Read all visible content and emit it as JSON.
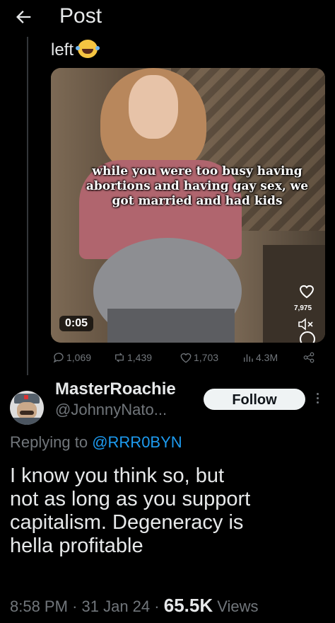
{
  "header": {
    "title": "Post",
    "back_icon": "arrow-left-icon"
  },
  "quoted_post": {
    "text": "left",
    "emoji": "face-with-tears-of-joy",
    "video": {
      "caption": "while you were too busy having abortions and having gay sex, we got married and had kids",
      "duration": "0:05",
      "overlay_likes": "7,975"
    },
    "stats": {
      "replies": "1,069",
      "reposts": "1,439",
      "likes": "1,703",
      "views": "4.3M"
    }
  },
  "reply": {
    "author_name": "MasterRoachie",
    "author_handle": "@JohnnyNato...",
    "follow_label": "Follow",
    "replying_prefix": "Replying to",
    "replying_to": "@RRR0BYN",
    "text": "I know you think so, but\nnot as long as you support\ncapitalism. Degeneracy is\nhella profitable",
    "time": "8:58 PM",
    "date": "31 Jan 24",
    "views_count": "65.5K",
    "views_label": "Views",
    "separator": "·"
  },
  "colors": {
    "background": "#000000",
    "text": "#e7e9ea",
    "muted": "#71767b",
    "link": "#1d9bf0",
    "follow_bg": "#eff3f4"
  }
}
